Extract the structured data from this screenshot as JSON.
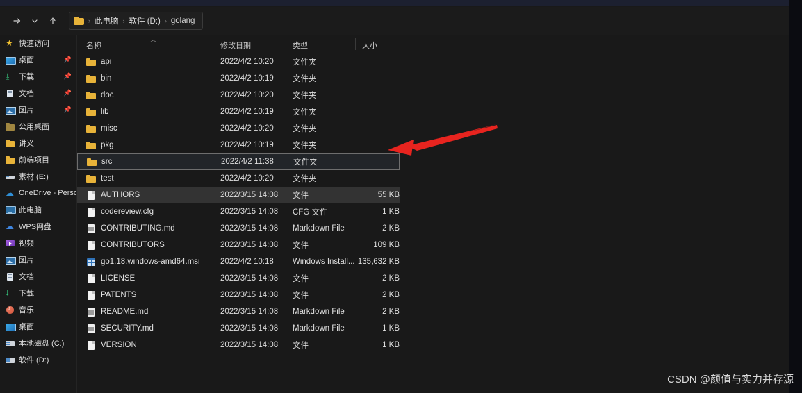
{
  "window": {
    "toolbar": {
      "forward_label": "→",
      "recent_label": "⌄",
      "up_label": "↑"
    },
    "address": {
      "folder_icon": "folder-icon",
      "separator": "›",
      "crumbs": [
        "此电脑",
        "软件 (D:)",
        "golang"
      ]
    }
  },
  "sidebar": {
    "items": [
      {
        "label": "快速访问",
        "icon": "star-icon",
        "pinned": false
      },
      {
        "label": "桌面",
        "icon": "desktop-icon",
        "pinned": true
      },
      {
        "label": "下载",
        "icon": "download-icon",
        "pinned": true
      },
      {
        "label": "文档",
        "icon": "document-icon",
        "pinned": true
      },
      {
        "label": "图片",
        "icon": "pictures-icon",
        "pinned": true
      },
      {
        "label": "公用桌面",
        "icon": "folder-dim-icon",
        "pinned": false
      },
      {
        "label": "讲义",
        "icon": "folder-icon",
        "pinned": false
      },
      {
        "label": "前端项目",
        "icon": "folder-icon",
        "pinned": false
      },
      {
        "label": "素材 (E:)",
        "icon": "drive-icon",
        "pinned": false
      },
      {
        "label": "OneDrive - Persor",
        "icon": "cloud-icon",
        "pinned": false
      },
      {
        "label": "此电脑",
        "icon": "this-pc-icon",
        "pinned": false
      },
      {
        "label": "WPS网盘",
        "icon": "wps-cloud-icon",
        "pinned": false
      },
      {
        "label": "视频",
        "icon": "video-icon",
        "pinned": false
      },
      {
        "label": "图片",
        "icon": "pictures-icon",
        "pinned": false
      },
      {
        "label": "文档",
        "icon": "document-icon",
        "pinned": false
      },
      {
        "label": "下载",
        "icon": "download-icon",
        "pinned": false
      },
      {
        "label": "音乐",
        "icon": "music-icon",
        "pinned": false
      },
      {
        "label": "桌面",
        "icon": "desktop-icon",
        "pinned": false
      },
      {
        "label": "本地磁盘 (C:)",
        "icon": "local-drive-icon",
        "pinned": false
      },
      {
        "label": "软件 (D:)",
        "icon": "local-drive-icon",
        "pinned": false
      }
    ]
  },
  "filelist": {
    "columns": {
      "name": "名称",
      "date": "修改日期",
      "type": "类型",
      "size": "大小"
    },
    "rows": [
      {
        "name": "api",
        "date": "2022/4/2 10:20",
        "type": "文件夹",
        "size": "",
        "icon": "folder-icon",
        "state": "normal"
      },
      {
        "name": "bin",
        "date": "2022/4/2 10:19",
        "type": "文件夹",
        "size": "",
        "icon": "folder-icon",
        "state": "normal"
      },
      {
        "name": "doc",
        "date": "2022/4/2 10:20",
        "type": "文件夹",
        "size": "",
        "icon": "folder-icon",
        "state": "normal"
      },
      {
        "name": "lib",
        "date": "2022/4/2 10:19",
        "type": "文件夹",
        "size": "",
        "icon": "folder-icon",
        "state": "normal"
      },
      {
        "name": "misc",
        "date": "2022/4/2 10:20",
        "type": "文件夹",
        "size": "",
        "icon": "folder-icon",
        "state": "normal"
      },
      {
        "name": "pkg",
        "date": "2022/4/2 10:19",
        "type": "文件夹",
        "size": "",
        "icon": "folder-icon",
        "state": "normal"
      },
      {
        "name": "src",
        "date": "2022/4/2 11:38",
        "type": "文件夹",
        "size": "",
        "icon": "folder-icon",
        "state": "selected"
      },
      {
        "name": "test",
        "date": "2022/4/2 10:20",
        "type": "文件夹",
        "size": "",
        "icon": "folder-icon",
        "state": "normal"
      },
      {
        "name": "AUTHORS",
        "date": "2022/3/15 14:08",
        "type": "文件",
        "size": "55 KB",
        "icon": "file-icon",
        "state": "hover"
      },
      {
        "name": "codereview.cfg",
        "date": "2022/3/15 14:08",
        "type": "CFG 文件",
        "size": "1 KB",
        "icon": "file-icon",
        "state": "normal"
      },
      {
        "name": "CONTRIBUTING.md",
        "date": "2022/3/15 14:08",
        "type": "Markdown File",
        "size": "2 KB",
        "icon": "markdown-icon",
        "state": "normal"
      },
      {
        "name": "CONTRIBUTORS",
        "date": "2022/3/15 14:08",
        "type": "文件",
        "size": "109 KB",
        "icon": "file-icon",
        "state": "normal"
      },
      {
        "name": "go1.18.windows-amd64.msi",
        "date": "2022/4/2 10:18",
        "type": "Windows Install...",
        "size": "135,632 KB",
        "icon": "installer-icon",
        "state": "normal"
      },
      {
        "name": "LICENSE",
        "date": "2022/3/15 14:08",
        "type": "文件",
        "size": "2 KB",
        "icon": "file-icon",
        "state": "normal"
      },
      {
        "name": "PATENTS",
        "date": "2022/3/15 14:08",
        "type": "文件",
        "size": "2 KB",
        "icon": "file-icon",
        "state": "normal"
      },
      {
        "name": "README.md",
        "date": "2022/3/15 14:08",
        "type": "Markdown File",
        "size": "2 KB",
        "icon": "markdown-icon",
        "state": "normal"
      },
      {
        "name": "SECURITY.md",
        "date": "2022/3/15 14:08",
        "type": "Markdown File",
        "size": "1 KB",
        "icon": "markdown-icon",
        "state": "normal"
      },
      {
        "name": "VERSION",
        "date": "2022/3/15 14:08",
        "type": "文件",
        "size": "1 KB",
        "icon": "file-icon",
        "state": "normal"
      }
    ]
  },
  "annotation": {
    "arrow_color": "#e8241f",
    "points_to": "src"
  },
  "watermark": {
    "text": "CSDN @颜值与实力并存源"
  }
}
